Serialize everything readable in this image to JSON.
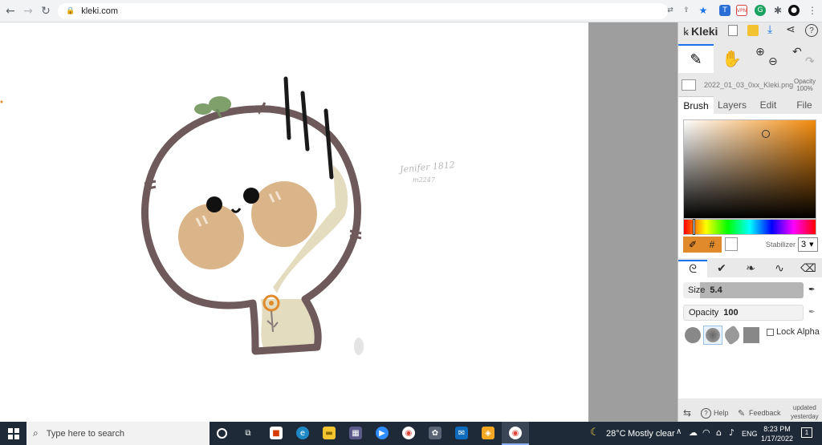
{
  "browser": {
    "url": "kleki.com",
    "back_icon": "←",
    "forward_icon": "→",
    "reload_icon": "↻"
  },
  "canvas": {
    "signature_line1": "Jenifer 1812",
    "signature_line2": "m2247"
  },
  "panel": {
    "app_name": "Kleki",
    "file_name": "2022_01_03_0xx_Kleki.png",
    "opacity_label": "Opacity",
    "opacity_value": "100%",
    "tabs": [
      "Brush",
      "Layers",
      "Edit",
      "File"
    ],
    "active_tab": "Brush",
    "hash_label": "#",
    "stabilizer_label": "Stabilizer",
    "stabilizer_value": "3",
    "size_label": "Size",
    "size_value": "5.4",
    "brush_opacity_label": "Opacity",
    "brush_opacity_value": "100",
    "lock_alpha_label": "Lock Alpha",
    "help_label": "Help",
    "feedback_label": "Feedback",
    "updated_line1": "updated",
    "updated_line2": "yesterday",
    "accent_color": "#e08a2c"
  },
  "taskbar": {
    "search_placeholder": "Type here to search",
    "weather_temp": "28°C",
    "weather_desc": "Mostly clear",
    "language": "ENG",
    "time": "8:23 PM",
    "date": "1/17/2022",
    "notification_count": "1"
  }
}
